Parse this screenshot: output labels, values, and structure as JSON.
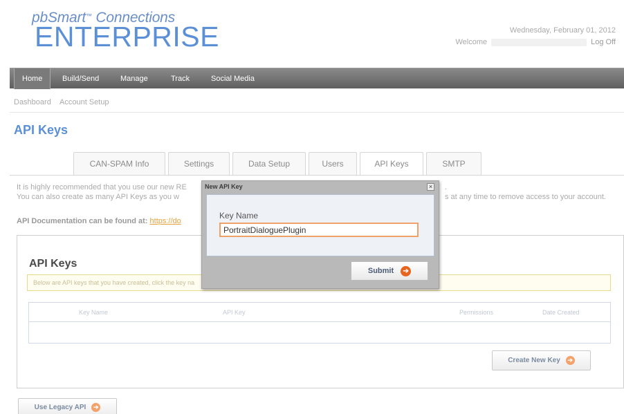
{
  "header": {
    "logo_top": "pbSmart",
    "logo_tm": "™",
    "logo_connections": "Connections",
    "logo_bottom": "ENTERPRISE",
    "date": "Wednesday, February 01, 2012",
    "welcome": "Welcome",
    "logoff": "Log Off"
  },
  "nav": {
    "items": [
      {
        "label": "Home",
        "active": true
      },
      {
        "label": "Build/Send"
      },
      {
        "label": "Manage"
      },
      {
        "label": "Track"
      },
      {
        "label": "Social Media"
      }
    ]
  },
  "subnav": {
    "items": [
      "Dashboard",
      "Account Setup"
    ]
  },
  "page": {
    "title": "API Keys"
  },
  "tabs": [
    {
      "label": "CAN-SPAM Info"
    },
    {
      "label": "Settings"
    },
    {
      "label": "Data Setup"
    },
    {
      "label": "Users"
    },
    {
      "label": "API Keys",
      "active": true
    },
    {
      "label": "SMTP"
    }
  ],
  "info": {
    "line1": "It is highly recommended that you use our new RE",
    "line2": "You can also create as many API Keys as you w",
    "line2_right": "s at any time to remove access to your account.",
    "line3_suffix": ".",
    "doc_prefix": "API Documentation can be found at:",
    "doc_link": "https://do"
  },
  "panel": {
    "title": "API Keys",
    "notice": "Below are API keys that you have created, click the key na",
    "columns": [
      "Key Name",
      "API Key",
      "Permissions",
      "Date Created"
    ],
    "create_button": "Create New Key"
  },
  "legacy_button": "Use Legacy API",
  "modal": {
    "title": "New API Key",
    "close": "×",
    "field_label": "Key Name",
    "field_value": "PortraitDialoguePlugin",
    "submit": "Submit"
  },
  "colors": {
    "brand_blue": "#5b8fd6",
    "nav_bg": "#6a6a6a",
    "accent_orange": "#e8641e"
  }
}
